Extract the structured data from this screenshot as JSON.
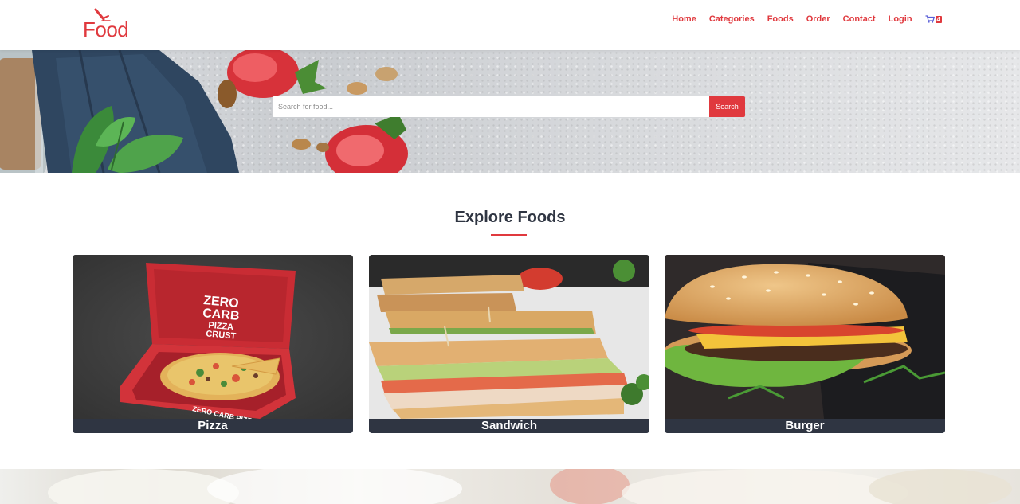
{
  "brand": {
    "logo_text": "Food"
  },
  "nav": {
    "items": [
      "Home",
      "Categories",
      "Foods",
      "Order",
      "Contact",
      "Login"
    ],
    "cart_count": "4"
  },
  "search": {
    "placeholder": "Search for food...",
    "button_label": "Search"
  },
  "explore": {
    "title": "Explore Foods",
    "categories": [
      {
        "label": "Pizza"
      },
      {
        "label": "Sandwich"
      },
      {
        "label": "Burger"
      }
    ]
  },
  "colors": {
    "accent": "#e0393e",
    "dark": "#2f3542"
  },
  "icons": [
    "fork-logo-icon",
    "cart-icon"
  ]
}
